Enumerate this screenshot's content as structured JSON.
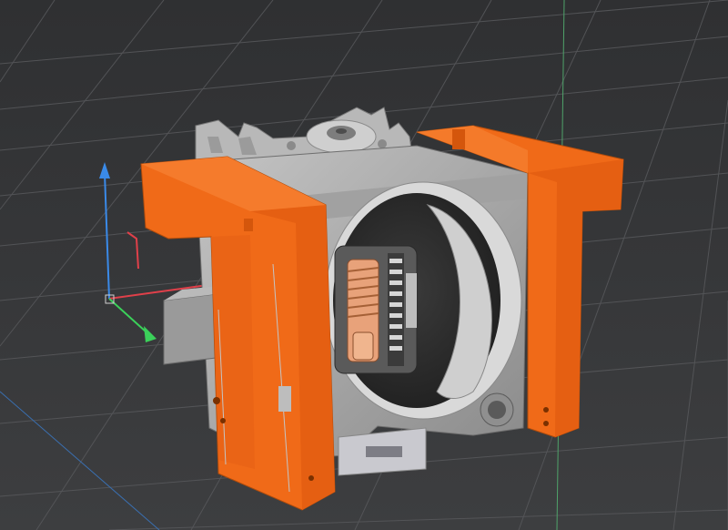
{
  "viewport": {
    "background": "#3a3b3d",
    "grid_color": "#5a5b5e",
    "axis_colors": {
      "x": "#e0404a",
      "y": "#3a8ae8",
      "z": "#3bd15a"
    }
  },
  "model": {
    "colors": {
      "orange": "#f06a18",
      "orange_dark": "#c24e0c",
      "gray": "#a9a9a9",
      "gray_dark": "#6f6f6f",
      "gray_light": "#c8c8c8",
      "copper": "#e8a27a"
    }
  }
}
